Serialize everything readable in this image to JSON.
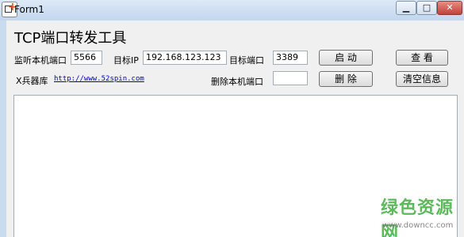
{
  "window": {
    "title": "Form1",
    "controls": {
      "minimize": "▁",
      "maximize": "□",
      "close": "✕"
    }
  },
  "app": {
    "heading": "TCP端口转发工具",
    "local_port_label": "监听本机端口",
    "local_port_value": "5566",
    "target_ip_label": "目标IP",
    "target_ip_value": "192.168.123.123",
    "target_port_label": "目标端口",
    "target_port_value": "3389",
    "start_button": "启 动",
    "view_button": "查 看",
    "arsenal_label": "X兵器库",
    "arsenal_link": "http://www.52spin.com",
    "delete_port_label": "删除本机端口",
    "delete_port_value": "",
    "delete_button": "删 除",
    "clear_button": "清空信息"
  },
  "watermark": {
    "text_cn": "绿色资源网",
    "url": "www.downcc.com"
  }
}
